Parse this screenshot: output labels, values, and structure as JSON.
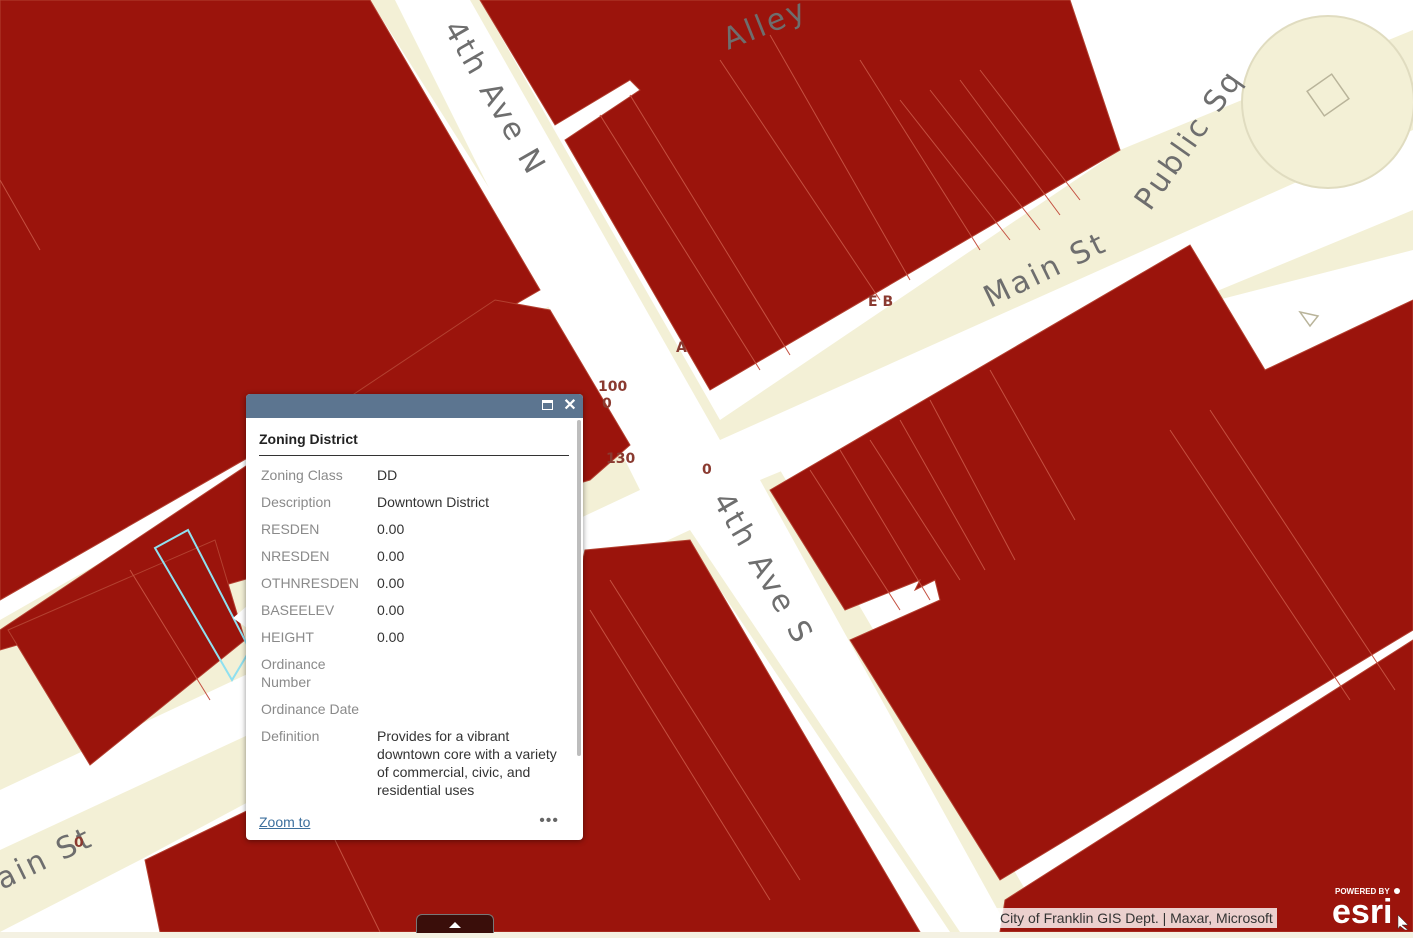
{
  "map": {
    "streets": {
      "fourth_ave_n": "4th Ave N",
      "fourth_ave_s": "4th Ave S",
      "main_st_east": "Main St",
      "main_st_west": "ain St",
      "alley": "Alley",
      "public_sq": "Public Sq"
    },
    "addresses": [
      "100",
      "130",
      "0",
      "0",
      "E B",
      "A",
      "0"
    ],
    "colors": {
      "parcel_fill": "#9b140c",
      "road": "#ffffff",
      "road_edge": "#efedd4",
      "selected_outline": "#8fe0f0"
    }
  },
  "popup": {
    "maximize_icon": "maximize-icon",
    "close_icon": "close-icon",
    "title": "Zoning District",
    "fields": [
      {
        "label": "Zoning Class",
        "value": "DD"
      },
      {
        "label": "Description",
        "value": "Downtown District"
      },
      {
        "label": "RESDEN",
        "value": "0.00"
      },
      {
        "label": "NRESDEN",
        "value": "0.00"
      },
      {
        "label": "OTHNRESDEN",
        "value": "0.00"
      },
      {
        "label": "BASEELEV",
        "value": "0.00"
      },
      {
        "label": "HEIGHT",
        "value": "0.00"
      },
      {
        "label": "Ordinance Number",
        "value": ""
      },
      {
        "label": "Ordinance Date",
        "value": ""
      },
      {
        "label": "Definition",
        "value": "Provides for a vibrant downtown core with a variety of commercial, civic, and residential uses"
      }
    ],
    "zoom_to": "Zoom to",
    "more": "•••"
  },
  "attribution": "City of Franklin GIS Dept. | Maxar, Microsoft",
  "esri": {
    "powered_by": "POWERED BY",
    "brand": "esri"
  }
}
